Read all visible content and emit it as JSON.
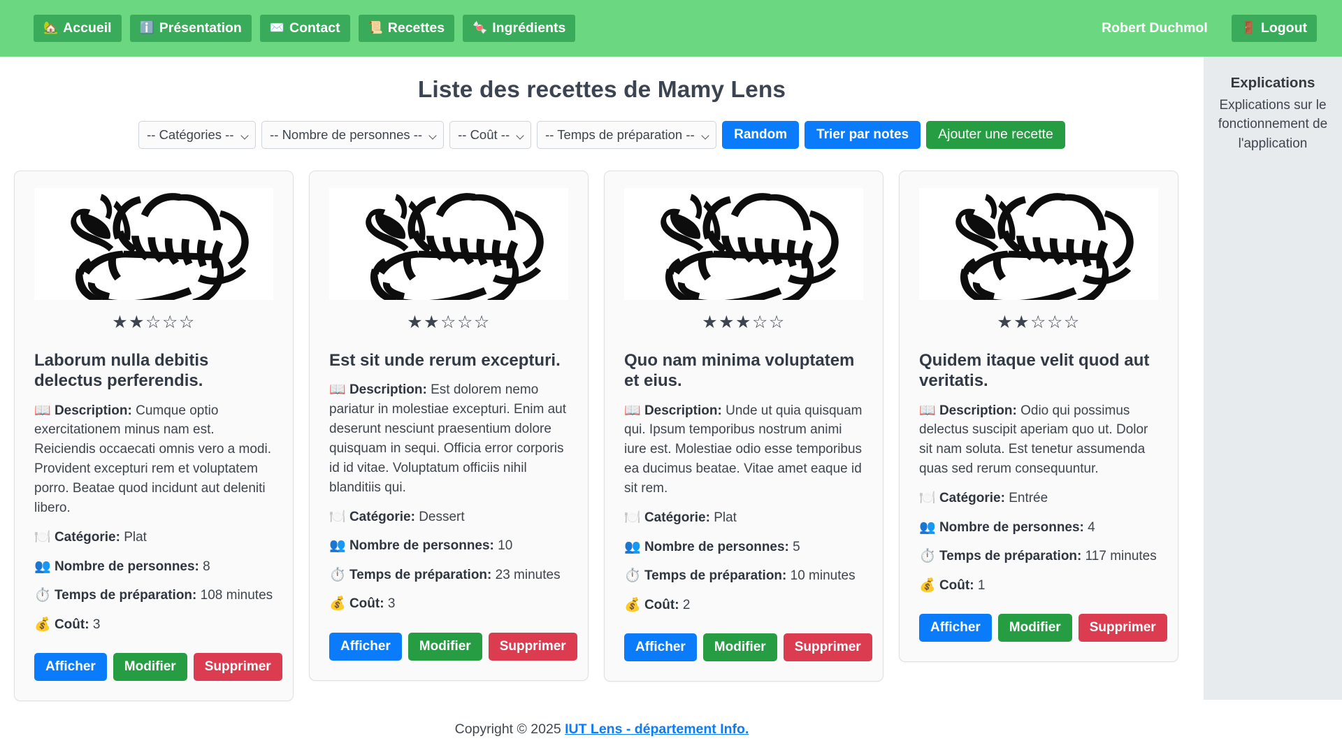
{
  "navbar": {
    "background_color": "#6bd881",
    "button_color": "#3aab5a",
    "links": [
      {
        "label": "Accueil",
        "icon": "house-icon",
        "glyph": "🏡"
      },
      {
        "label": "Présentation",
        "icon": "info-icon",
        "glyph": "ℹ️"
      },
      {
        "label": "Contact",
        "icon": "envelope-icon",
        "glyph": "✉️"
      },
      {
        "label": "Recettes",
        "icon": "scroll-icon",
        "glyph": "📜"
      },
      {
        "label": "Ingrédients",
        "icon": "candy-icon",
        "glyph": "🍬"
      }
    ],
    "user_name": "Robert Duchmol",
    "logout_label": "Logout",
    "logout_icon": "door-icon",
    "logout_glyph": "🚪"
  },
  "main": {
    "page_title": "Liste des recettes de Mamy Lens",
    "filters": [
      {
        "name": "categories",
        "selected": "-- Catégories --"
      },
      {
        "name": "personnes",
        "selected": "-- Nombre de personnes --"
      },
      {
        "name": "cout",
        "selected": "-- Coût --"
      },
      {
        "name": "temps",
        "selected": "-- Temps de préparation --"
      }
    ],
    "buttons": {
      "random": "Random",
      "sort_by_notes": "Trier par notes",
      "add_recipe": "Ajouter une recette"
    },
    "labels": {
      "description": "Description:",
      "categorie": "Catégorie:",
      "personnes": "Nombre de personnes:",
      "temps": "Temps de préparation:",
      "cout": "Coût:",
      "minutes_suffix": " minutes"
    },
    "icons": {
      "description": "open-book-icon",
      "description_glyph": "📖",
      "categorie": "fork-knife-icon",
      "categorie_glyph": "🍽️",
      "personnes": "people-icon",
      "personnes_glyph": "👥",
      "temps": "stopwatch-icon",
      "temps_glyph": "⏱️",
      "cout": "money-bag-icon",
      "cout_glyph": "💰"
    },
    "actions": {
      "show": "Afficher",
      "edit": "Modifier",
      "delete": "Supprimer"
    },
    "image_alt": "chef-hat-illustration",
    "star_filled": "★",
    "star_empty": "☆",
    "max_stars": 5,
    "recipes": [
      {
        "rating": 2,
        "title": "Laborum nulla debitis delectus perferendis.",
        "description": "Cumque optio exercitationem minus nam est. Reiciendis occaecati omnis vero a modi. Provident excepturi rem et voluptatem porro. Beatae quod incidunt aut deleniti libero.",
        "categorie": "Plat",
        "personnes": "8",
        "temps": "108",
        "cout": "3"
      },
      {
        "rating": 2,
        "title": "Est sit unde rerum excepturi.",
        "description": "Est dolorem nemo pariatur in molestiae excepturi. Enim aut deserunt nesciunt praesentium dolore quisquam in sequi. Officia error corporis id id vitae. Voluptatum officiis nihil blanditiis qui.",
        "categorie": "Dessert",
        "personnes": "10",
        "temps": "23",
        "cout": "3"
      },
      {
        "rating": 3,
        "title": "Quo nam minima voluptatem et eius.",
        "description": "Unde ut quia quisquam qui. Ipsum temporibus nostrum animi iure est. Molestiae odio esse temporibus ea ducimus beatae. Vitae amet eaque id sit rem.",
        "categorie": "Plat",
        "personnes": "5",
        "temps": "10",
        "cout": "2"
      },
      {
        "rating": 2,
        "title": "Quidem itaque velit quod aut veritatis.",
        "description": "Odio qui possimus delectus suscipit aperiam quo ut. Dolor sit nam soluta. Est tenetur assumenda quas sed rerum consequuntur.",
        "categorie": "Entrée",
        "personnes": "4",
        "temps": "117",
        "cout": "1"
      }
    ]
  },
  "sidebar": {
    "title": "Explications",
    "text": "Explications sur le fonctionnement de l'application",
    "background_color": "#e8ebed"
  },
  "footer": {
    "copyright": "Copyright © 2025 ",
    "link_label": "IUT Lens - département Info.",
    "link_color": "#0a7cfb"
  }
}
